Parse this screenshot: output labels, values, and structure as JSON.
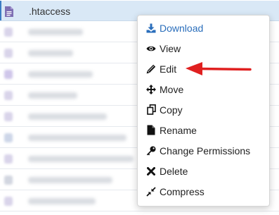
{
  "file_list": {
    "selected_file": {
      "name": ".htaccess",
      "icon": "document-icon"
    },
    "blurred_rows": 9
  },
  "context_menu": {
    "items": [
      {
        "label": "Download",
        "icon": "download-icon",
        "primary": true
      },
      {
        "label": "View",
        "icon": "eye-icon"
      },
      {
        "label": "Edit",
        "icon": "pencil-icon",
        "highlighted_by_arrow": true
      },
      {
        "label": "Move",
        "icon": "move-arrows-icon"
      },
      {
        "label": "Copy",
        "icon": "copy-icon"
      },
      {
        "label": "Rename",
        "icon": "file-icon"
      },
      {
        "label": "Change Permissions",
        "icon": "key-icon"
      },
      {
        "label": "Delete",
        "icon": "x-icon"
      },
      {
        "label": "Compress",
        "icon": "compress-icon"
      }
    ]
  },
  "colors": {
    "accent": "#2a6ebb",
    "selected_row": "#d9e8f6",
    "annotation_arrow": "#e02020"
  }
}
